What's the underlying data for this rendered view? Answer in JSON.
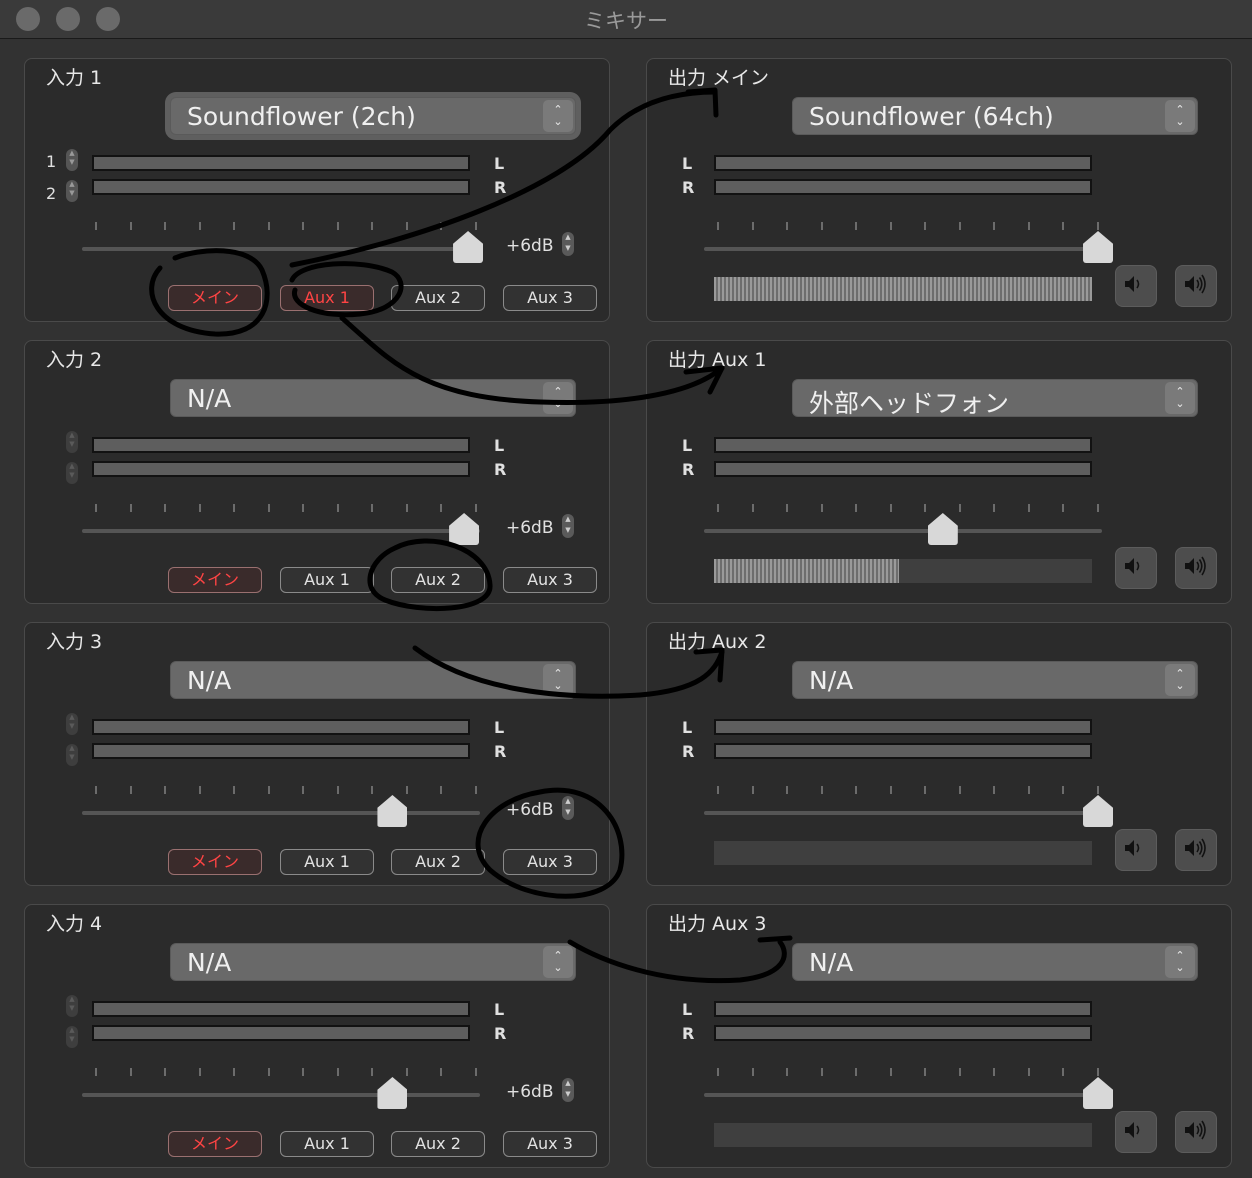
{
  "window": {
    "title": "ミキサー"
  },
  "inputs": [
    {
      "title": "入力 1",
      "source": "Soundflower (2ch)",
      "channel_1": "1",
      "channel_2": "2",
      "left_label": "L",
      "right_label": "R",
      "gain": "+6dB",
      "fader_level": 0.97,
      "sends": [
        "メイン",
        "Aux 1",
        "Aux 2",
        "Aux 3"
      ],
      "active_sends": [
        "メイン",
        "Aux 1"
      ]
    },
    {
      "title": "入力 2",
      "source": "N/A",
      "left_label": "L",
      "right_label": "R",
      "gain": "+6dB",
      "fader_level": 0.96,
      "sends": [
        "メイン",
        "Aux 1",
        "Aux 2",
        "Aux 3"
      ],
      "active_sends": [
        "メイン"
      ]
    },
    {
      "title": "入力 3",
      "source": "N/A",
      "left_label": "L",
      "right_label": "R",
      "gain": "+6dB",
      "fader_level": 0.78,
      "sends": [
        "メイン",
        "Aux 1",
        "Aux 2",
        "Aux 3"
      ],
      "active_sends": [
        "メイン"
      ]
    },
    {
      "title": "入力 4",
      "source": "N/A",
      "left_label": "L",
      "right_label": "R",
      "gain": "+6dB",
      "fader_level": 0.78,
      "sends": [
        "メイン",
        "Aux 1",
        "Aux 2",
        "Aux 3"
      ],
      "active_sends": [
        "メイン"
      ]
    }
  ],
  "outputs": [
    {
      "title": "出力 メイン",
      "device": "Soundflower (64ch)",
      "left_label": "L",
      "right_label": "R",
      "fader_level": 0.99,
      "meter_level": 1.0
    },
    {
      "title": "出力 Aux 1",
      "device": "外部ヘッドフォン",
      "left_label": "L",
      "right_label": "R",
      "fader_level": 0.6,
      "meter_level": 0.49
    },
    {
      "title": "出力 Aux 2",
      "device": "N/A",
      "left_label": "L",
      "right_label": "R",
      "fader_level": 0.99,
      "meter_level": 0.0
    },
    {
      "title": "出力 Aux 3",
      "device": "N/A",
      "left_label": "L",
      "right_label": "R",
      "fader_level": 0.99,
      "meter_level": 0.0
    }
  ],
  "icons": {
    "volume_down": "speaker-low-icon",
    "volume_up": "speaker-high-icon",
    "select_arrows": "updown-chevron-icon"
  },
  "colors": {
    "active_send": "#ff4444",
    "annotation": "#000000"
  }
}
